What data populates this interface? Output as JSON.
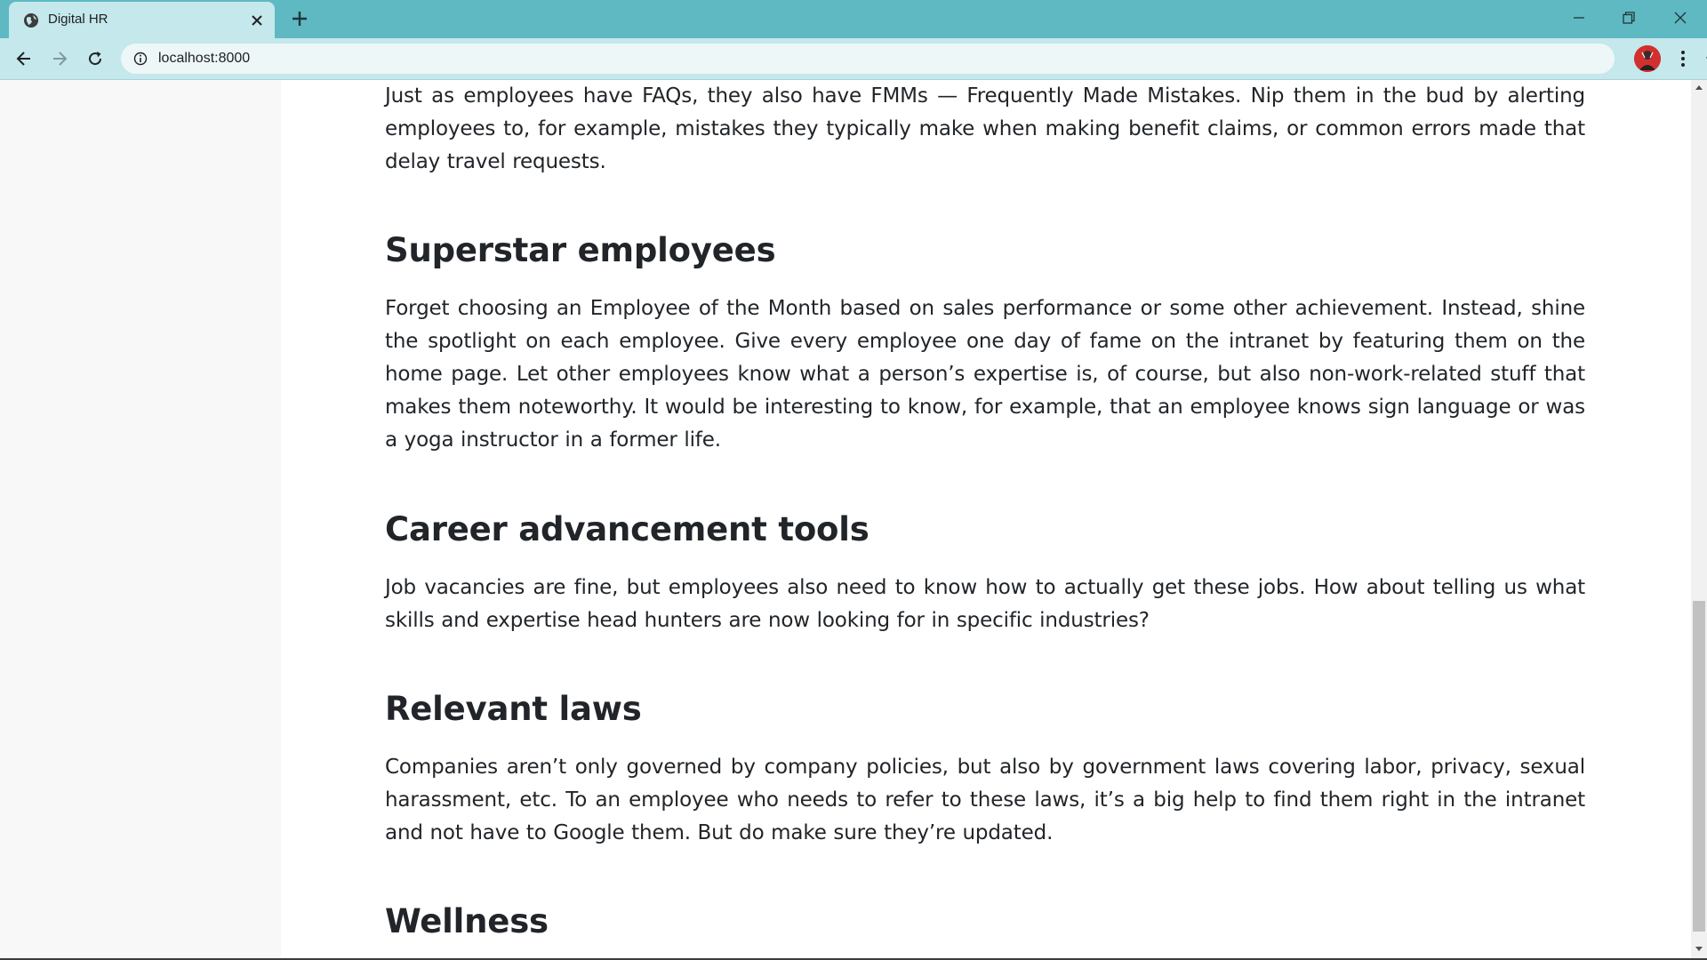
{
  "browser": {
    "tab_title": "Digital HR",
    "url": "localhost:8000"
  },
  "article": {
    "intro_paragraph": "Just as employees have FAQs, they also have FMMs — Frequently Made Mistakes. Nip them in the bud by alerting employees to, for example, mistakes they typically make when making benefit claims, or common errors made that delay travel requests.",
    "sections": [
      {
        "heading": "Superstar employees",
        "body": "Forget choosing an Employee of the Month based on sales performance or some other achievement. Instead, shine the spotlight on each employee. Give every employee one day of fame on the intranet by featuring them on the home page. Let other employees know what a person’s expertise is, of course, but also non-work-related stuff that makes them noteworthy. It would be interesting to know, for example, that an employee knows sign language or was a yoga instructor in a former life."
      },
      {
        "heading": "Career advancement tools",
        "body": "Job vacancies are fine, but employees also need to know how to actually get these jobs. How about telling us what skills and expertise head hunters are now looking for in specific industries?"
      },
      {
        "heading": "Relevant laws",
        "body": "Companies aren’t only governed by company policies, but also by government laws covering labor, privacy, sexual harassment, etc. To an employee who needs to refer to these laws, it’s a big help to find them right in the intranet and not have to Google them. But do make sure they’re updated."
      },
      {
        "heading": "Wellness"
      }
    ]
  }
}
